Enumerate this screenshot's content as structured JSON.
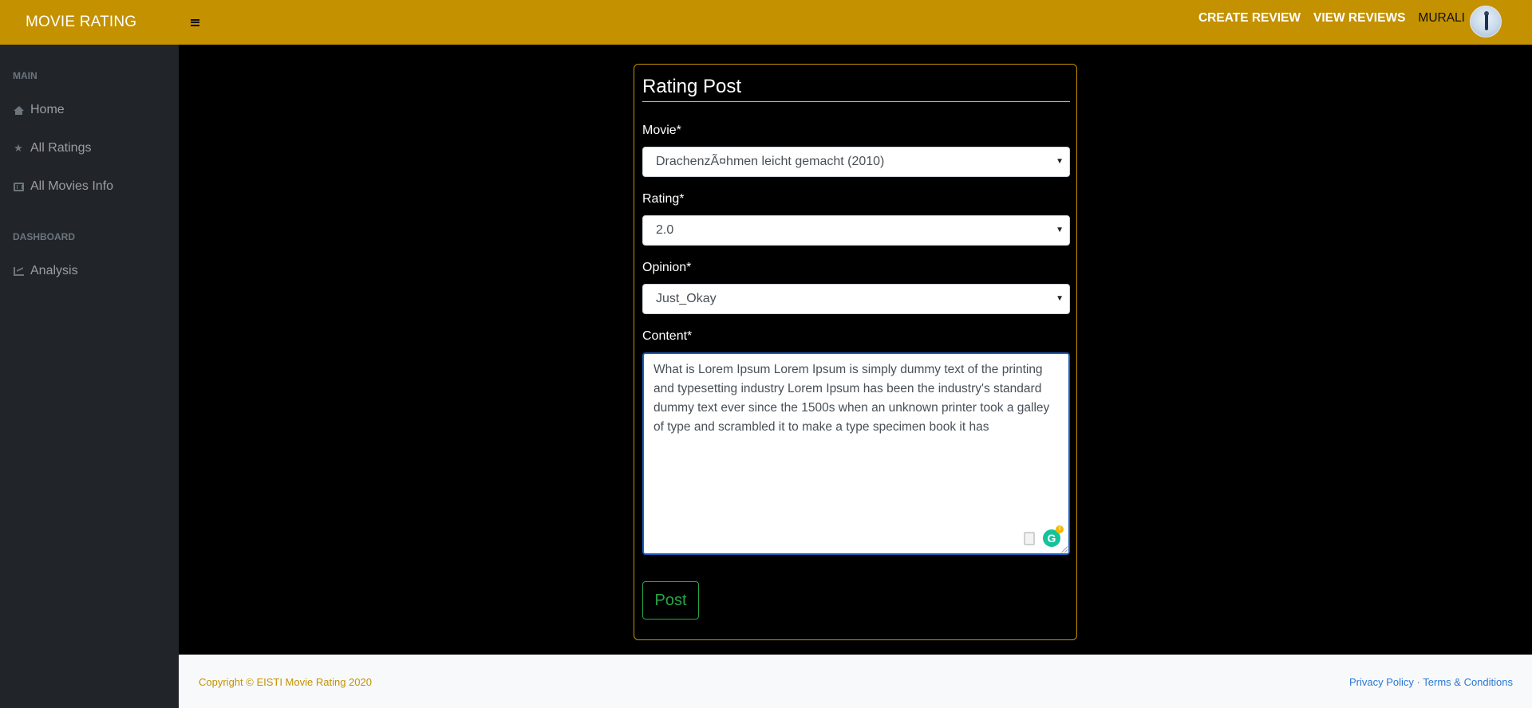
{
  "brand": {
    "title": "MOVIE RATING"
  },
  "topnav": {
    "create_review": "CREATE REVIEW",
    "view_reviews": "VIEW REVIEWS",
    "user_name": "MURALI"
  },
  "sidebar": {
    "sections": [
      {
        "heading": "MAIN"
      },
      {
        "heading": "DASHBOARD"
      }
    ],
    "items": [
      {
        "label": "Home",
        "icon": "home-icon"
      },
      {
        "label": "All Ratings",
        "icon": "star-icon"
      },
      {
        "label": "All Movies Info",
        "icon": "film-icon"
      },
      {
        "label": "Analysis",
        "icon": "chart-icon"
      }
    ]
  },
  "form": {
    "title": "Rating Post",
    "movie": {
      "label": "Movie*",
      "value": "DrachenzÃ¤hmen leicht gemacht (2010)"
    },
    "rating": {
      "label": "Rating*",
      "value": "2.0"
    },
    "opinion": {
      "label": "Opinion*",
      "value": "Just_Okay"
    },
    "content": {
      "label": "Content*",
      "value": "What is Lorem Ipsum Lorem Ipsum is simply dummy text of the printing and typesetting industry Lorem Ipsum has been the industry's standard dummy text ever since the 1500s when an unknown printer took a galley of type and scrambled it to make a type specimen book it has"
    },
    "submit_label": "Post"
  },
  "footer": {
    "copyright": "Copyright © EISTI Movie Rating 2020",
    "privacy": "Privacy Policy",
    "separator": "·",
    "terms": "Terms & Conditions"
  },
  "colors": {
    "navbar": "#c49100",
    "sidebar": "#212529",
    "accent_green": "#28a745",
    "link_blue": "#2a78d6"
  }
}
